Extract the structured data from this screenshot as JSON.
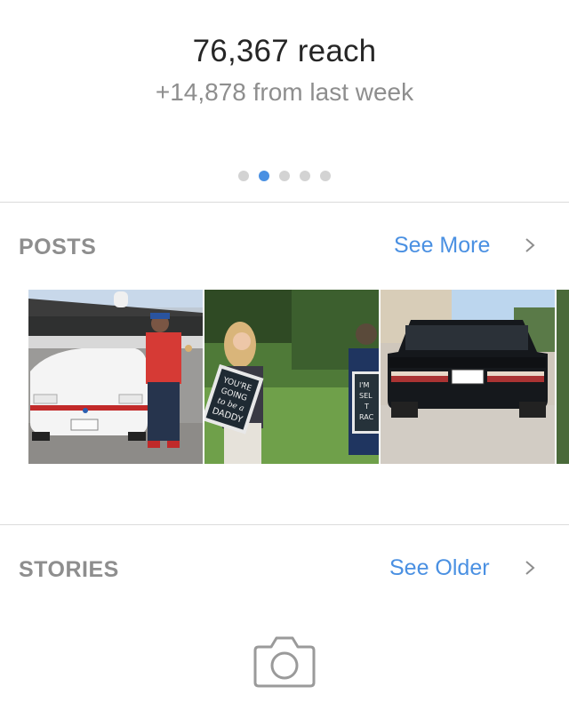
{
  "insights": {
    "reach_label": "76,367 reach",
    "delta_label": "+14,878 from last week",
    "carousel": {
      "count": 5,
      "active_index": 1
    }
  },
  "posts": {
    "title": "POSTS",
    "action_label": "See More",
    "thumbnails": [
      {
        "icon": "white-convertible-photo"
      },
      {
        "icon": "pregnancy-announcement-photo",
        "sign_lines": [
          "YOU'RE",
          "GOING",
          "to be a",
          "DADDY"
        ],
        "sign2_lines": [
          "I'M",
          "SEL",
          "T",
          "RAC"
        ]
      },
      {
        "icon": "black-car-rear-photo"
      }
    ]
  },
  "stories": {
    "title": "STORIES",
    "action_label": "See Older"
  },
  "colors": {
    "accent": "#4a90e2",
    "muted_text": "#8e8e8e",
    "primary_text": "#262626"
  }
}
